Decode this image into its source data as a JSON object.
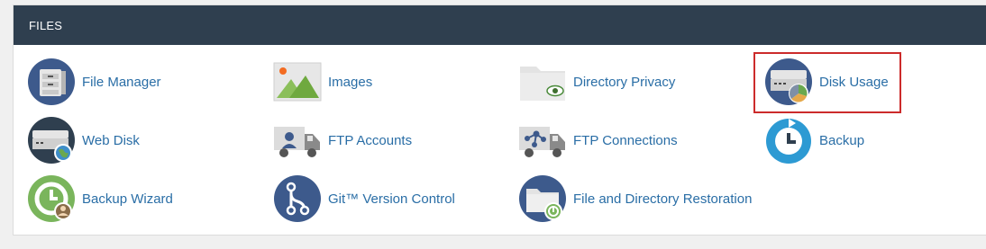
{
  "section": {
    "title": "FILES"
  },
  "items": [
    {
      "label": "File Manager",
      "icon": "file-manager-icon"
    },
    {
      "label": "Images",
      "icon": "images-icon"
    },
    {
      "label": "Directory Privacy",
      "icon": "directory-privacy-icon"
    },
    {
      "label": "Disk Usage",
      "icon": "disk-usage-icon"
    },
    {
      "label": "Web Disk",
      "icon": "web-disk-icon"
    },
    {
      "label": "FTP Accounts",
      "icon": "ftp-accounts-icon"
    },
    {
      "label": "FTP Connections",
      "icon": "ftp-connections-icon"
    },
    {
      "label": "Backup",
      "icon": "backup-icon"
    },
    {
      "label": "Backup Wizard",
      "icon": "backup-wizard-icon"
    },
    {
      "label": "Git™ Version Control",
      "icon": "git-version-control-icon"
    },
    {
      "label": "File and Directory Restoration",
      "icon": "file-directory-restoration-icon"
    }
  ],
  "colors": {
    "header_bg": "#2f3f4f",
    "link": "#2a6ea6",
    "highlight": "#cc2b2b"
  }
}
